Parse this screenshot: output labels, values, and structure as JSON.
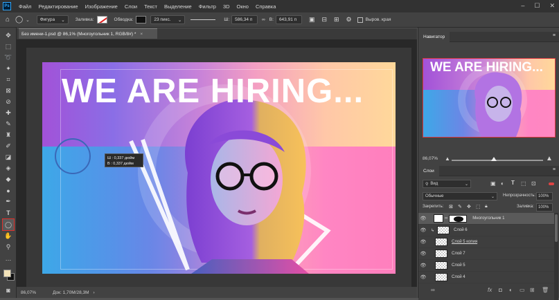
{
  "menubar": {
    "logo": "Ps",
    "items": [
      "Файл",
      "Редактирование",
      "Изображение",
      "Слои",
      "Текст",
      "Выделение",
      "Фильтр",
      "3D",
      "Окно",
      "Справка"
    ]
  },
  "options": {
    "shape_mode": "Фигура",
    "fill_label": "Заливка:",
    "stroke_label": "Обводка:",
    "stroke_size": "23 пикс.",
    "w_label": "Ш:",
    "w_value": "586,34 п",
    "h_label": "В:",
    "h_value": "643,91 п",
    "align_edges": "Выров. края"
  },
  "document": {
    "tab_title": "Без имени-1.psd @ 86,1% (Многоугольник 1, RGB/8#) *",
    "headline": "WE ARE HIRING...",
    "tooltip_w": "Ш :  0,337 дюйм",
    "tooltip_h": "В :  0,337 дюйм"
  },
  "status": {
    "zoom": "86,07%",
    "doc": "Док: 1,70M/28,3M"
  },
  "navigator": {
    "title": "Навигатор",
    "headline": "WE ARE HIRING...",
    "zoom": "86,07%"
  },
  "layers": {
    "title": "Слои",
    "kind_filter": "Вид",
    "blend_mode": "Обычные",
    "opacity_label": "Непрозрачность:",
    "opacity_value": "100%",
    "lock_label": "Закрепить:",
    "fill_label": "Заливка:",
    "fill_value": "100%",
    "items": [
      {
        "name": "Многоугольник 1"
      },
      {
        "name": "Слой 6"
      },
      {
        "name": "Слой 5 копия"
      },
      {
        "name": "Слой 7"
      },
      {
        "name": "Слой 5"
      },
      {
        "name": "Слой 4"
      }
    ]
  },
  "colors": {
    "accent": "#31a8ff",
    "selected_tool_outline": "#e0302b",
    "foreground": "#f2e2b8",
    "background": "#111111"
  }
}
